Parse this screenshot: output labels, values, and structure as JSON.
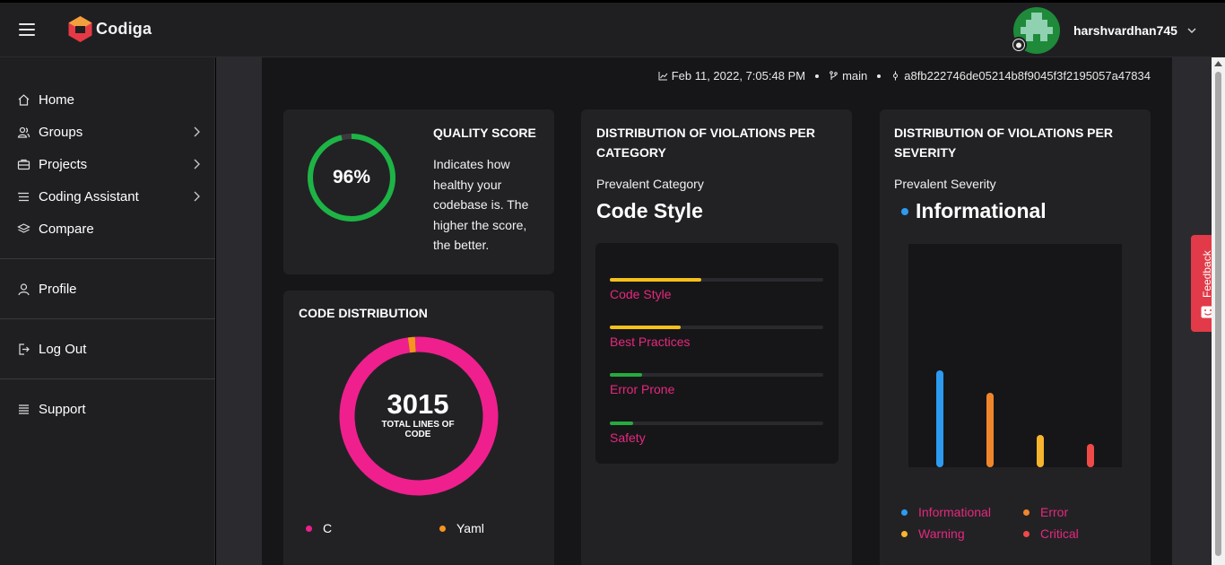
{
  "header": {
    "logo_text": "Codiga",
    "username": "harshvardhan745"
  },
  "sidebar": {
    "items": [
      {
        "label": "Home",
        "icon": "home-icon"
      },
      {
        "label": "Groups",
        "icon": "groups-icon"
      },
      {
        "label": "Projects",
        "icon": "projects-icon"
      },
      {
        "label": "Coding Assistant",
        "icon": "coding-assistant-icon"
      },
      {
        "label": "Compare",
        "icon": "compare-icon"
      },
      {
        "label": "Profile",
        "icon": "user-icon"
      },
      {
        "label": "Log Out",
        "icon": "logout-icon"
      },
      {
        "label": "Support",
        "icon": "support-icon"
      }
    ]
  },
  "meta": {
    "date": "Feb 11, 2022, 7:05:48 PM",
    "branch": "main",
    "commit": "a8fb222746de05214b8f9045f3f2195057a47834"
  },
  "quality": {
    "title": "QUALITY SCORE",
    "score_label": "96%",
    "score": 96,
    "description": "Indicates how healthy your codebase is. The higher the score, the better.",
    "color": "#1db445"
  },
  "code_distribution": {
    "title": "CODE DISTRIBUTION",
    "total": "3015",
    "total_label": "TOTAL LINES OF CODE",
    "languages": [
      {
        "name": "C",
        "color": "#ef1f8e",
        "share": 0.985
      },
      {
        "name": "Yaml",
        "color": "#f7941d",
        "share": 0.015
      }
    ]
  },
  "category": {
    "title": "DISTRIBUTION OF VIOLATIONS PER CATEGORY",
    "prevalent_label": "Prevalent Category",
    "prevalent_value": "Code Style",
    "bars": [
      {
        "label": "Code Style",
        "fraction": 0.43,
        "color": "#f4c01b"
      },
      {
        "label": "Best Practices",
        "fraction": 0.33,
        "color": "#f4c01b"
      },
      {
        "label": "Error Prone",
        "fraction": 0.15,
        "color": "#25ab3e"
      },
      {
        "label": "Safety",
        "fraction": 0.11,
        "color": "#25ab3e"
      }
    ]
  },
  "severity": {
    "title": "DISTRIBUTION OF VIOLATIONS PER SEVERITY",
    "prevalent_label": "Prevalent Severity",
    "prevalent_value": "Informational",
    "prevalent_color": "#2d9bf0",
    "bars": [
      {
        "name": "Informational",
        "fraction": 1.0,
        "color": "#2d9bf0"
      },
      {
        "name": "Error",
        "fraction": 0.77,
        "color": "#f0862c"
      },
      {
        "name": "Warning",
        "fraction": 0.33,
        "color": "#f7b52d"
      },
      {
        "name": "Critical",
        "fraction": 0.24,
        "color": "#ef4a48"
      }
    ]
  },
  "feedback": {
    "label": "Feedback",
    "color": "#e23a48"
  }
}
